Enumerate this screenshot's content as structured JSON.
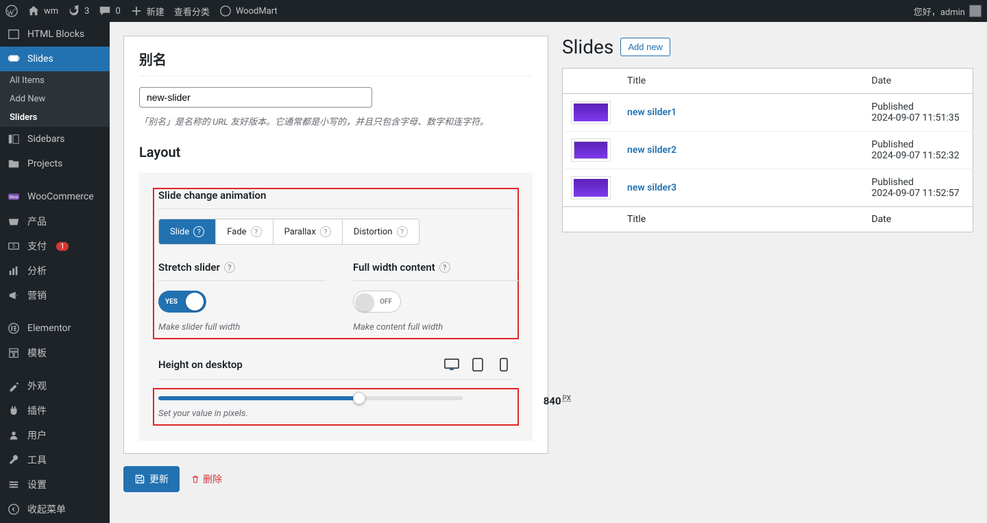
{
  "adminbar": {
    "site_name": "wm",
    "updates": "3",
    "comments": "0",
    "new": "新建",
    "view_cats": "查看分类",
    "woodmart": "WoodMart",
    "greeting": "您好，admin"
  },
  "menu": {
    "html_blocks": "HTML Blocks",
    "slides": "Slides",
    "all_items": "All Items",
    "add_new": "Add New",
    "sliders": "Sliders",
    "sidebars": "Sidebars",
    "projects": "Projects",
    "woocommerce": "WooCommerce",
    "products": "产品",
    "payments": "支付",
    "payments_badge": "1",
    "analytics": "分析",
    "marketing": "营销",
    "elementor": "Elementor",
    "templates": "模板",
    "appearance": "外观",
    "plugins": "插件",
    "users": "用户",
    "tools": "工具",
    "settings": "设置",
    "collapse": "收起菜单"
  },
  "form": {
    "alias_title": "别名",
    "alias_value": "new-slider",
    "alias_desc": "「别名」是名称的 URL 友好版本。它通常都是小写的，并且只包含字母、数字和连字符。",
    "layout_title": "Layout",
    "slide_anim_title": "Slide change animation",
    "anim_slide": "Slide",
    "anim_fade": "Fade",
    "anim_parallax": "Parallax",
    "anim_distortion": "Distortion",
    "stretch_title": "Stretch slider",
    "stretch_on": "YES",
    "stretch_desc": "Make slider full width",
    "fullwidth_title": "Full width content",
    "fullwidth_off": "OFF",
    "fullwidth_desc": "Make content full width",
    "height_title": "Height on desktop",
    "height_value": "840",
    "height_unit": "PX",
    "height_desc": "Set your value in pixels.",
    "update_btn": "更新",
    "delete_btn": "删除"
  },
  "slides": {
    "title": "Slides",
    "add_new": "Add new",
    "col_title": "Title",
    "col_date": "Date",
    "rows": [
      {
        "title": "new silder1",
        "status": "Published",
        "time": "2024-09-07 11:51:35"
      },
      {
        "title": "new silder2",
        "status": "Published",
        "time": "2024-09-07 11:52:32"
      },
      {
        "title": "new silder3",
        "status": "Published",
        "time": "2024-09-07 11:52:57"
      }
    ]
  }
}
